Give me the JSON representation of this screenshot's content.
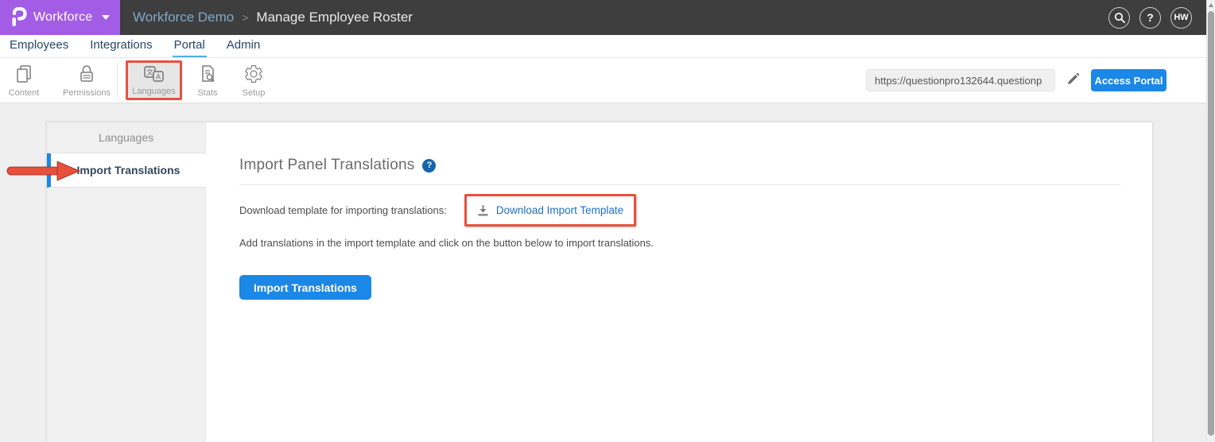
{
  "topbar": {
    "brand": "Workforce",
    "breadcrumb": {
      "parent": "Workforce Demo",
      "separator": ">",
      "current": "Manage Employee Roster"
    },
    "help_glyph": "?",
    "avatar_initials": "HW"
  },
  "nav": {
    "items": [
      {
        "label": "Employees"
      },
      {
        "label": "Integrations"
      },
      {
        "label": "Portal"
      },
      {
        "label": "Admin"
      }
    ],
    "active": "Portal"
  },
  "toolbar": {
    "items": [
      {
        "label": "Content",
        "icon": "pages-icon"
      },
      {
        "label": "Permissions",
        "icon": "lock-icon"
      },
      {
        "label": "Languages",
        "icon": "translate-icon",
        "selected": true,
        "annotated": true
      },
      {
        "label": "Stats",
        "icon": "page-search-icon"
      },
      {
        "label": "Setup",
        "icon": "gear-icon"
      }
    ],
    "url_value": "https://questionpro132644.questionp",
    "access_portal_label": "Access Portal"
  },
  "sidebar": {
    "header": "Languages",
    "items": [
      {
        "label": "Import Translations",
        "active": true
      }
    ]
  },
  "main": {
    "title": "Import Panel Translations",
    "help_glyph": "?",
    "download_label": "Download template for importing translations:",
    "download_link_label": "Download Import Template",
    "instructions": "Add translations in the import template and click on the button below to import translations.",
    "import_button_label": "Import Translations"
  },
  "colors": {
    "brand_purple": "#a35ce6",
    "topbar_gray": "#3e3e3e",
    "accent_blue": "#1b87e6",
    "link_blue": "#1d6fc5",
    "nav_underline": "#4cb2e2",
    "annotation_red": "#e8503c",
    "help_badge_blue": "#1565ad"
  }
}
